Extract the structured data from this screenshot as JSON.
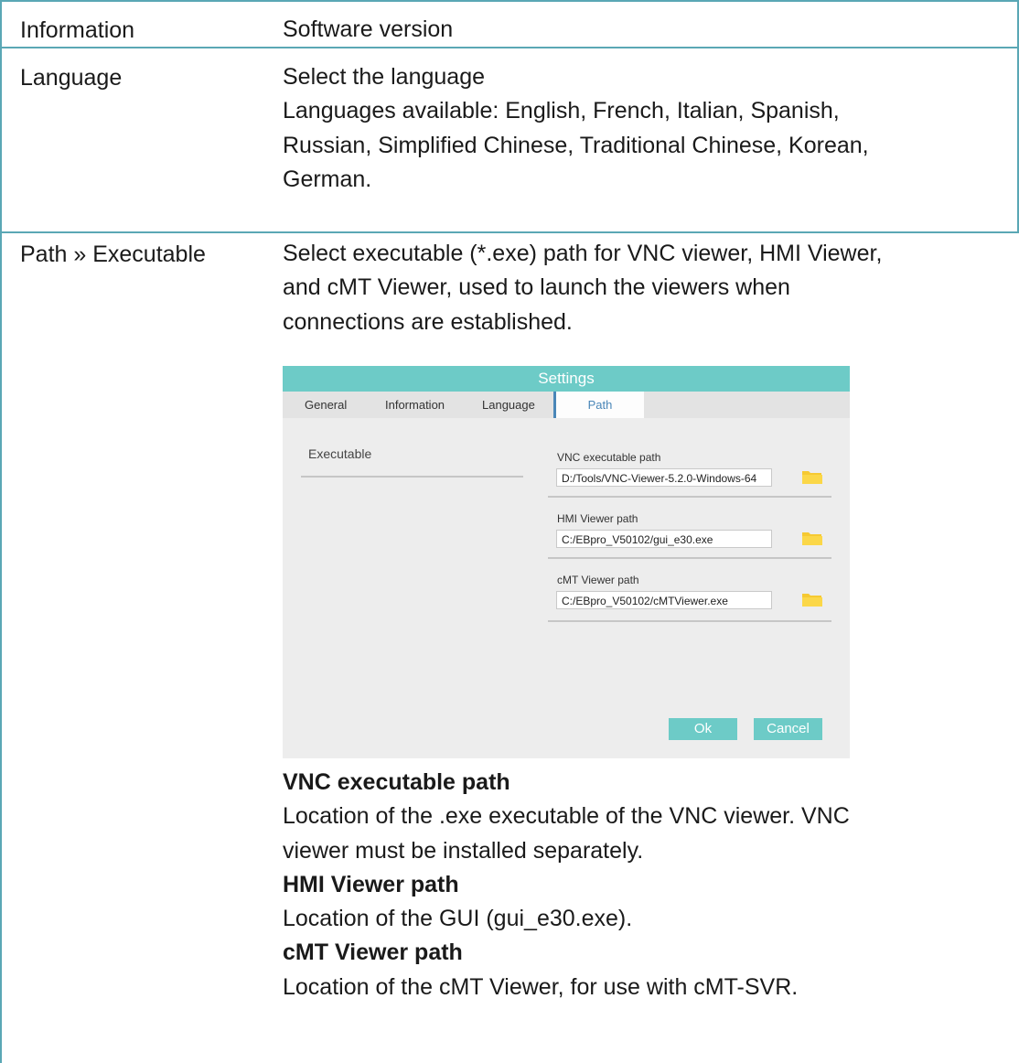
{
  "rows": [
    {
      "label": "Information",
      "lines": [
        "Software version"
      ]
    },
    {
      "label": "Language",
      "lines": [
        "Select the language",
        "Languages available: English, French, Italian, Spanish,",
        "Russian, Simplified Chinese, Traditional Chinese, Korean,",
        "German."
      ]
    },
    {
      "label": "Path » Executable",
      "lines": [
        "Select executable (*.exe) path for VNC viewer, HMI Viewer,",
        "and cMT Viewer, used to launch the viewers when",
        "connections are established."
      ]
    }
  ],
  "dialog": {
    "title": "Settings",
    "tabs": [
      "General",
      "Information",
      "Language",
      "Path"
    ],
    "active_tab": "Path",
    "section": "Executable",
    "fields": [
      {
        "label": "VNC executable path",
        "value": "D:/Tools/VNC-Viewer-5.2.0-Windows-64"
      },
      {
        "label": "HMI Viewer path",
        "value": "C:/EBpro_V50102/gui_e30.exe"
      },
      {
        "label": "cMT Viewer path",
        "value": "C:/EBpro_V50102/cMTViewer.exe"
      }
    ],
    "ok_label": "Ok",
    "cancel_label": "Cancel",
    "colors": {
      "title_bar": "#6dcbc7",
      "active_tab": "#4a87b8",
      "folder": "#f6c932",
      "table_border": "#5aa7b5"
    }
  },
  "details": [
    {
      "heading": "VNC executable path",
      "lines": [
        "Location of the .exe executable of the VNC viewer. VNC",
        "viewer must be installed separately."
      ]
    },
    {
      "heading": "HMI Viewer path",
      "lines": [
        "Location of the GUI (gui_e30.exe)."
      ]
    },
    {
      "heading": "cMT Viewer path",
      "lines": [
        "Location of the cMT Viewer, for use with cMT-SVR."
      ]
    }
  ]
}
